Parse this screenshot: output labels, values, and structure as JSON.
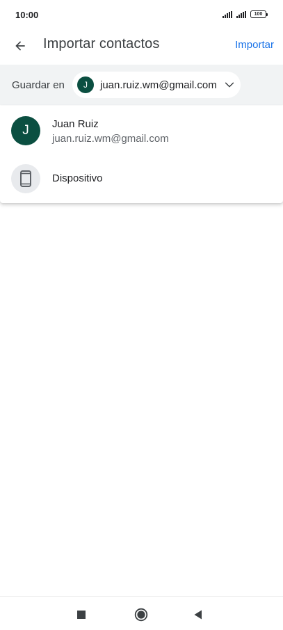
{
  "status_bar": {
    "time": "10:00",
    "battery": "100",
    "icons": [
      "signal-icon",
      "signal-icon",
      "battery-icon"
    ]
  },
  "app_bar": {
    "back_icon": "arrow-back-icon",
    "title": "Importar contactos",
    "import_label": "Importar"
  },
  "save_in": {
    "label": "Guardar en",
    "account_initial": "J",
    "account_email": "juan.ruiz.wm@gmail.com",
    "caret_icon": "chevron-down-icon"
  },
  "menu": {
    "items": [
      {
        "initial": "J",
        "name": "Juan Ruiz",
        "email": "juan.ruiz.wm@gmail.com"
      },
      {
        "icon": "phone-device-icon",
        "name": "Dispositivo"
      }
    ]
  },
  "nav_bar": {
    "icons": [
      "recents-icon",
      "home-icon",
      "back-icon"
    ]
  },
  "colors": {
    "accent": "#1a73e8",
    "avatar": "#0b4f41",
    "save_row_bg": "#f1f3f4"
  }
}
